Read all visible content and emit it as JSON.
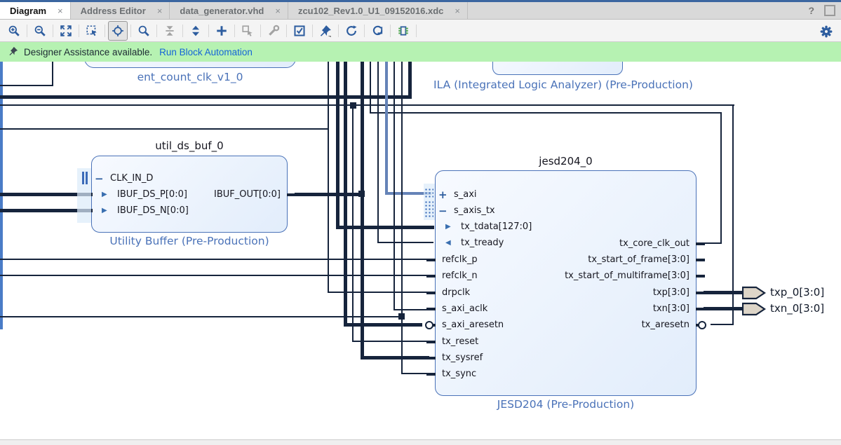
{
  "window": {
    "help_icon": "?",
    "float_icon": ""
  },
  "tabs": [
    {
      "label": "Diagram",
      "active": true,
      "closable": true
    },
    {
      "label": "Address Editor",
      "active": false,
      "closable": true
    },
    {
      "label": "data_generator.vhd",
      "active": false,
      "closable": true
    },
    {
      "label": "zcu102_Rev1.0_U1_09152016.xdc",
      "active": false,
      "closable": true
    }
  ],
  "toolbar": {
    "buttons": [
      {
        "name": "zoom-in"
      },
      {
        "name": "zoom-out"
      },
      {
        "name": "zoom-fit"
      },
      {
        "name": "zoom-to-selection"
      },
      {
        "name": "center-view",
        "selected": true
      },
      {
        "name": "search"
      },
      {
        "name": "collapse-hierarchy",
        "disabled": true
      },
      {
        "name": "expand-hierarchy"
      },
      {
        "name": "add-ip"
      },
      {
        "name": "copy",
        "disabled": true
      },
      {
        "name": "customize-block",
        "disabled": true
      },
      {
        "name": "validate-design"
      },
      {
        "name": "pin"
      },
      {
        "name": "refresh"
      },
      {
        "name": "regenerate-layout"
      },
      {
        "name": "interface-ports"
      }
    ],
    "settings_button": {
      "name": "settings"
    }
  },
  "banner": {
    "message": "Designer Assistance available.",
    "link_label": "Run Block Automation"
  },
  "diagram": {
    "blocks": {
      "ent_count": {
        "label": "ent_count_clk_v1_0"
      },
      "ila": {
        "label": "ILA (Integrated Logic Analyzer) (Pre-Production)"
      },
      "util_ds_buf": {
        "title": "util_ds_buf_0",
        "type_label": "Utility Buffer (Pre-Production)",
        "left_ports": [
          {
            "name": "CLK_IN_D",
            "kind": "iface-expanded"
          },
          {
            "name": "IBUF_DS_P[0:0]",
            "kind": "in"
          },
          {
            "name": "IBUF_DS_N[0:0]",
            "kind": "in"
          }
        ],
        "right_ports": [
          {
            "name": "IBUF_OUT[0:0]",
            "kind": "plain"
          }
        ]
      },
      "jesd204": {
        "title": "jesd204_0",
        "type_label": "JESD204 (Pre-Production)",
        "left_ports": [
          {
            "name": "s_axi",
            "kind": "iface-collapsed"
          },
          {
            "name": "s_axis_tx",
            "kind": "iface-expanded"
          },
          {
            "name": "tx_tdata[127:0]",
            "kind": "in"
          },
          {
            "name": "tx_tready",
            "kind": "out-left"
          },
          {
            "name": "refclk_p",
            "kind": "plain"
          },
          {
            "name": "refclk_n",
            "kind": "plain"
          },
          {
            "name": "drpclk",
            "kind": "plain"
          },
          {
            "name": "s_axi_aclk",
            "kind": "plain"
          },
          {
            "name": "s_axi_aresetn",
            "kind": "plain-inv"
          },
          {
            "name": "tx_reset",
            "kind": "plain"
          },
          {
            "name": "tx_sysref",
            "kind": "plain"
          },
          {
            "name": "tx_sync",
            "kind": "plain"
          }
        ],
        "right_ports": [
          {
            "name": "tx_core_clk_out",
            "kind": "plain"
          },
          {
            "name": "tx_start_of_frame[3:0]",
            "kind": "plain"
          },
          {
            "name": "tx_start_of_multiframe[3:0]",
            "kind": "plain"
          },
          {
            "name": "txp[3:0]",
            "kind": "plain"
          },
          {
            "name": "txn[3:0]",
            "kind": "plain"
          },
          {
            "name": "tx_aresetn",
            "kind": "plain-inv"
          }
        ]
      }
    },
    "external_ports": [
      {
        "label": "txp_0[3:0]"
      },
      {
        "label": "txn_0[3:0]"
      }
    ]
  },
  "colors": {
    "accent_blue": "#2d5d9f",
    "label_blue": "#4a72b8",
    "wire": "#16243c",
    "interface_wire": "#6583b7",
    "banner_bg": "#b6f2b2",
    "link_blue": "#1464d8",
    "block_border": "#4a72b8",
    "ext_port_fill": "#ddd5c8"
  }
}
